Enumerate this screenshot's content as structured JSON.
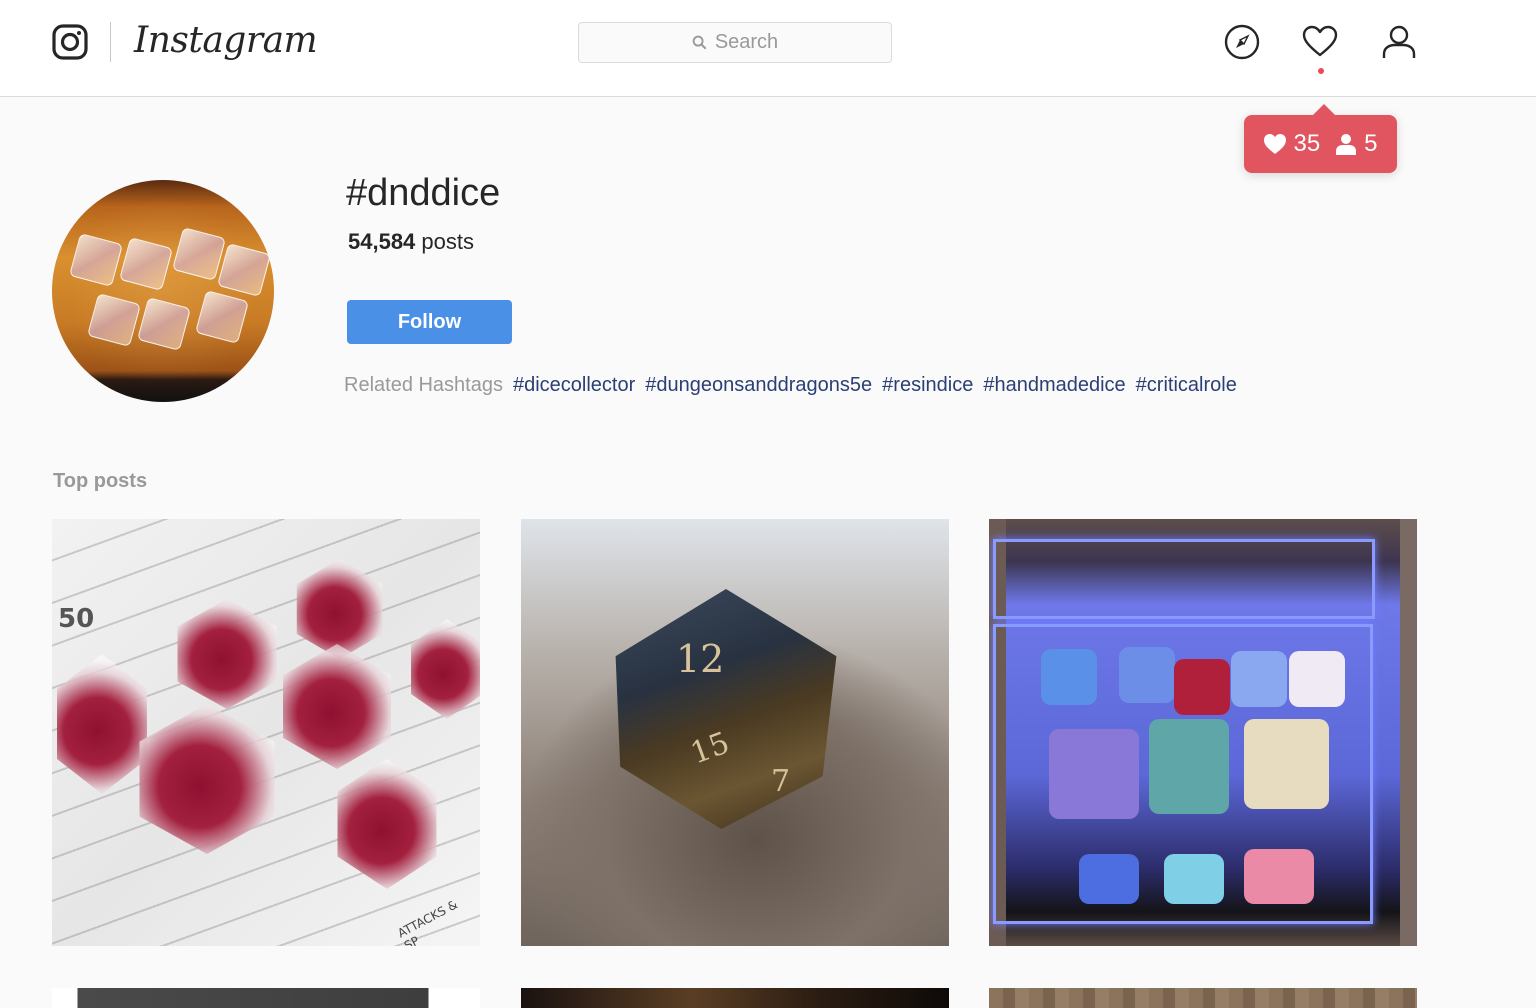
{
  "header": {
    "brand": "Instagram",
    "search": {
      "placeholder": "Search",
      "value": ""
    },
    "nav_icons": [
      "compass-icon",
      "heart-icon",
      "profile-icon"
    ]
  },
  "notifications": {
    "likes": "35",
    "followers": "5",
    "color": "#e0555f"
  },
  "hashtag": {
    "title": "#dnddice",
    "post_count": "54,584",
    "post_count_label": "posts",
    "follow_label": "Follow",
    "follow_color": "#4a90e6",
    "related_label": "Related Hashtags",
    "related": [
      "#dicecollector",
      "#dungeonsanddragons5e",
      "#resindice",
      "#handmadedice",
      "#criticalrole"
    ]
  },
  "top_posts": {
    "label": "Top posts",
    "posts": [
      {
        "alt": "Clear resin dice with red swirls on a character sheet"
      },
      {
        "alt": "Smoky brown resin d20 showing 12 on driftwood"
      },
      {
        "alt": "Blue-lit acrylic dice display case full of dice"
      },
      {
        "alt": "Post thumbnail (partially visible)"
      },
      {
        "alt": "Post thumbnail (partially visible)"
      },
      {
        "alt": "Post thumbnail (partially visible)"
      }
    ],
    "image_text": {
      "sheet_number": "50",
      "sheet_caption": "ATTACKS & SP",
      "d20_top": "12",
      "d20_lower": "15",
      "d20_side": "7"
    }
  }
}
